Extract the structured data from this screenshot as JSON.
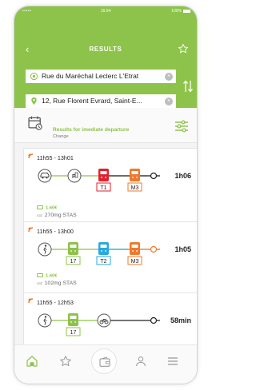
{
  "status": {
    "carrier": "•••••",
    "time": "16:04",
    "battery": "100%"
  },
  "header": {
    "title": "RESULTS"
  },
  "origin": {
    "value": "Rue du Maréchal Leclerc L'Etrat"
  },
  "destination": {
    "value": "12, Rue Florent Evrard, Saint-E..."
  },
  "departure": {
    "title": "Results for imediate departure",
    "change_label": "Change"
  },
  "results": [
    {
      "time": "11h55 - 13h01",
      "duration": "1h06",
      "price": "1.60€",
      "co2_label": "co2",
      "co2": "270mg",
      "operator": "STAS",
      "lines": [
        "T1",
        "M3"
      ]
    },
    {
      "time": "11h55 - 13h00",
      "duration": "1h05",
      "price": "1.60€",
      "co2_label": "co2",
      "co2": "102mg",
      "operator": "STAS",
      "lines": [
        "17",
        "T2",
        "M3"
      ]
    },
    {
      "time": "11h55 - 12h53",
      "duration": "58min",
      "lines": [
        "17"
      ]
    }
  ],
  "colors": {
    "accent": "#8dc34a",
    "tram_red": "#e2212f",
    "metro_orange": "#f0792e",
    "tram_blue": "#2aa9e0"
  },
  "tabbar": {
    "icons": [
      "home-icon",
      "star-icon",
      "wallet-icon",
      "user-icon",
      "menu-icon"
    ]
  }
}
